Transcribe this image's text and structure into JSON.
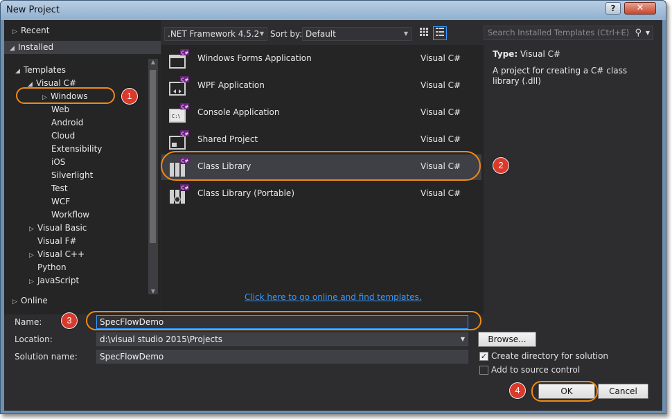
{
  "window": {
    "title": "New Project",
    "help_label": "?",
    "close_label": "✕"
  },
  "tree": {
    "recent": "Recent",
    "installed": "Installed",
    "templates": "Templates",
    "visual_csharp": "Visual C#",
    "children": [
      "Windows",
      "Web",
      "Android",
      "Cloud",
      "Extensibility",
      "iOS",
      "Silverlight",
      "Test",
      "WCF",
      "Workflow"
    ],
    "visual_basic": "Visual Basic",
    "visual_fsharp": "Visual F#",
    "visual_cpp": "Visual C++",
    "python": "Python",
    "javascript": "JavaScript",
    "online": "Online"
  },
  "toolbar": {
    "framework": ".NET Framework 4.5.2",
    "sort_label": "Sort by:",
    "sort_value": "Default",
    "search_placeholder": "Search Installed Templates (Ctrl+E)"
  },
  "templates": [
    {
      "name": "Windows Forms Application",
      "lang": "Visual C#",
      "icon": "winforms-icon"
    },
    {
      "name": "WPF Application",
      "lang": "Visual C#",
      "icon": "wpf-icon"
    },
    {
      "name": "Console Application",
      "lang": "Visual C#",
      "icon": "console-icon"
    },
    {
      "name": "Shared Project",
      "lang": "Visual C#",
      "icon": "shared-project-icon"
    },
    {
      "name": "Class Library",
      "lang": "Visual C#",
      "icon": "class-library-icon"
    },
    {
      "name": "Class Library (Portable)",
      "lang": "Visual C#",
      "icon": "portable-library-icon"
    }
  ],
  "online_link": "Click here to go online and find templates.",
  "description": {
    "type_label": "Type:",
    "type_value": "Visual C#",
    "text": "A project for creating a C# class library (.dll)"
  },
  "form": {
    "name_label": "Name:",
    "name_value": "SpecFlowDemo",
    "location_label": "Location:",
    "location_value": "d:\\visual studio 2015\\Projects",
    "solution_label": "Solution name:",
    "solution_value": "SpecFlowDemo",
    "browse_label": "Browse...",
    "create_dir_label": "Create directory for solution",
    "source_control_label": "Add to source control",
    "ok_label": "OK",
    "cancel_label": "Cancel"
  },
  "callouts": [
    "1",
    "2",
    "3",
    "4"
  ],
  "colors": {
    "accent": "#3399ff",
    "callout_ring": "#f28a14",
    "callout_badge": "#d93a2b",
    "background": "#2d2d30"
  }
}
